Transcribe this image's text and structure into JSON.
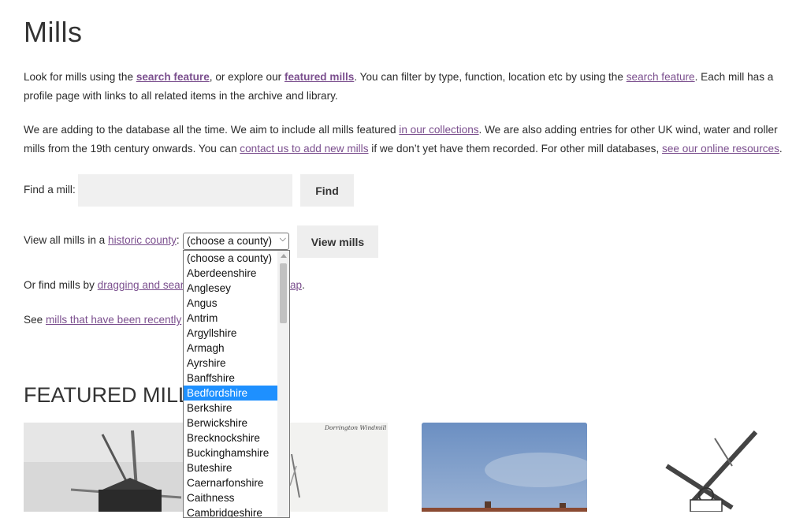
{
  "page": {
    "title": "Mills"
  },
  "intro": {
    "t1": "Look for mills using the ",
    "link_search1": "search feature",
    "t2": ", or explore our ",
    "link_featured": "featured mills",
    "t3": ". You can filter by type, function, location etc by using the ",
    "link_search2": "search feature",
    "t4": ". Each mill has a profile page with links to all related items in the archive and library."
  },
  "database_note": {
    "t1": "We are adding to the database all the time. We aim to include all mills featured ",
    "link_collections": "in our collections",
    "t2": ". We are also adding entries for other UK wind, water and roller mills from the 19th century onwards. You can ",
    "link_contact": "contact us to add new mills",
    "t3": " if we don’t yet have them recorded. For other mill databases, ",
    "link_resources": "see our online resources",
    "t4": "."
  },
  "find": {
    "label": "Find a mill:",
    "placeholder": "",
    "button": "Find"
  },
  "county": {
    "label_prefix": "View all mills in a ",
    "label_link": "historic county",
    "label_suffix": ":",
    "select_value": "(choose a county)",
    "button": "View mills",
    "options": [
      "(choose a county)",
      "Aberdeenshire",
      "Anglesey",
      "Angus",
      "Antrim",
      "Argyllshire",
      "Armagh",
      "Ayrshire",
      "Banffshire",
      "Bedfordshire",
      "Berkshire",
      "Berwickshire",
      "Brecknockshire",
      "Buckinghamshire",
      "Buteshire",
      "Caernarfonshire",
      "Caithness",
      "Cambridgeshire"
    ],
    "highlighted": "Bedfordshire"
  },
  "map_line": {
    "prefix": "Or find mills by ",
    "link": "dragging and sear",
    "link_tail": "ap",
    "suffix": "."
  },
  "recent_line": {
    "prefix": "See ",
    "link": "mills that have been recently"
  },
  "featured": {
    "title": "FEATURED MILLS",
    "caption_2": "Dorrington Windmill"
  },
  "colors": {
    "link": "#7b4f8e",
    "button_bg": "#eeeeee",
    "highlight": "#1e90ff"
  }
}
